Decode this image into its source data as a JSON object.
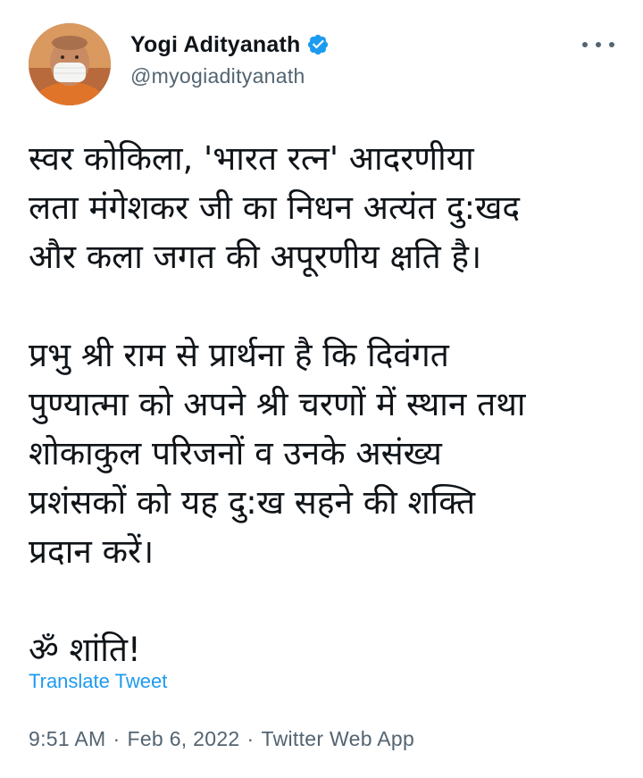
{
  "author": {
    "display_name": "Yogi Adityanath",
    "handle": "@myogiadityanath",
    "avatar_icon": "profile-photo",
    "verified_icon": "verified-badge-icon",
    "verified_color": "#1d9bf0"
  },
  "menu": {
    "icon": "more-options-icon"
  },
  "tweet": {
    "paragraphs": [
      "स्वर कोकिला, 'भारत रत्न' आदरणीया\nलता मंगेशकर जी का निधन अत्यंत दु:खद\nऔर कला जगत की अपूरणीय क्षति है।",
      "प्रभु श्री राम से प्रार्थना है कि दिवंगत\nपुण्यात्मा को अपने श्री चरणों में स्थान तथा\nशोकाकुल परिजनों व उनके असंख्य\nप्रशंसकों को यह दु:ख सहने की शक्ति\nप्रदान करें।",
      "ॐ शांति!"
    ],
    "translate_label": "Translate Tweet"
  },
  "meta": {
    "time": "9:51 AM",
    "separator": "·",
    "date": "Feb 6, 2022",
    "source": "Twitter Web App"
  },
  "colors": {
    "text": "#0f1419",
    "secondary": "#536471",
    "link": "#1d9bf0"
  }
}
